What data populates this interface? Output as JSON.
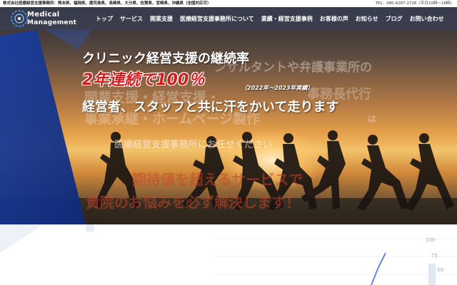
{
  "topbar": {
    "offices": "株式会社医療経営支援事務所：熊本県、福岡県、鹿児島県、長崎県、大分県、佐賀県、宮崎県、沖縄県（全国対応可）",
    "phone": "TEL：080-4287-2726（平日10時〜18時）"
  },
  "logo": {
    "line1": "Medical",
    "line2": "Management",
    "icon": "logo-mark-icon"
  },
  "nav": {
    "items": [
      "トップ",
      "サービス",
      "開業支援",
      "医療経営支援事務所について",
      "業績・経営支援事例",
      "お客様の声",
      "お知らせ",
      "ブログ",
      "お問い合わせ"
    ]
  },
  "hero": {
    "headline1": "クリニック経営支援の継続率",
    "headline2": "2年連続で100％",
    "headline2_note": "（2022年〜2023年実績）",
    "headline3": "経営者、スタッフと共に汗をかいて走ります",
    "ghost": {
      "g1": "ンサルタントや弁護事業所の",
      "g2": "開業支援・経営支援・",
      "g3": "事務長代行",
      "g4": "事業承継・ホームページ製作",
      "g5": "医療経営支援事務所にお任せください",
      "g6": "は",
      "g7": "期待値を超えるサービスで",
      "g8": "貴院のお悩みを必ず解決します！"
    }
  },
  "chart_ticks": [
    "100",
    "75",
    "50"
  ],
  "colors": {
    "accent_red": "#d51b1b",
    "nav_bg": "#3a4052",
    "brand_blue": "#1d3f9c"
  }
}
